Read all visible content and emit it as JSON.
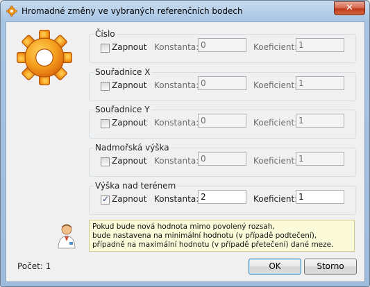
{
  "window": {
    "title": "Hromadné změny ve vybraných referenčních bodech",
    "close_glyph": "✕"
  },
  "groups": [
    {
      "title": "Číslo",
      "checkbox_label": "Zapnout",
      "checked": false,
      "constant_label": "Konstanta:",
      "constant_value": "0",
      "coefficient_label": "Koeficient:",
      "coefficient_value": "1"
    },
    {
      "title": "Souřadnice X",
      "checkbox_label": "Zapnout",
      "checked": false,
      "constant_label": "Konstanta:",
      "constant_value": "0",
      "coefficient_label": "Koeficient:",
      "coefficient_value": "1"
    },
    {
      "title": "Souřadnice Y",
      "checkbox_label": "Zapnout",
      "checked": false,
      "constant_label": "Konstanta:",
      "constant_value": "0",
      "coefficient_label": "Koeficient:",
      "coefficient_value": "1"
    },
    {
      "title": "Nadmořská výška",
      "checkbox_label": "Zapnout",
      "checked": false,
      "constant_label": "Konstanta:",
      "constant_value": "0",
      "coefficient_label": "Koeficient:",
      "coefficient_value": "1"
    },
    {
      "title": "Výška nad terénem",
      "checkbox_label": "Zapnout",
      "checked": true,
      "constant_label": "Konstanta:",
      "constant_value": "2",
      "coefficient_label": "Koeficient:",
      "coefficient_value": "1"
    }
  ],
  "info": {
    "lines": [
      "Pokud bude nová hodnota mimo povolený rozsah,",
      "bude nastavena na minimální hodnotu (v případě podtečení),",
      "případně na maximální hodnotu (v případě přetečení) dané meze."
    ]
  },
  "footer": {
    "count_text": "Počet: 1",
    "ok_label": "OK",
    "cancel_label": "Storno"
  },
  "icons": {
    "title": "gear-icon",
    "main": "gear-icon",
    "info": "user-icon"
  },
  "colors": {
    "gear_orange": "#f39a1e",
    "info_background": "#fbfbd9",
    "close_button": "#c7422a"
  }
}
